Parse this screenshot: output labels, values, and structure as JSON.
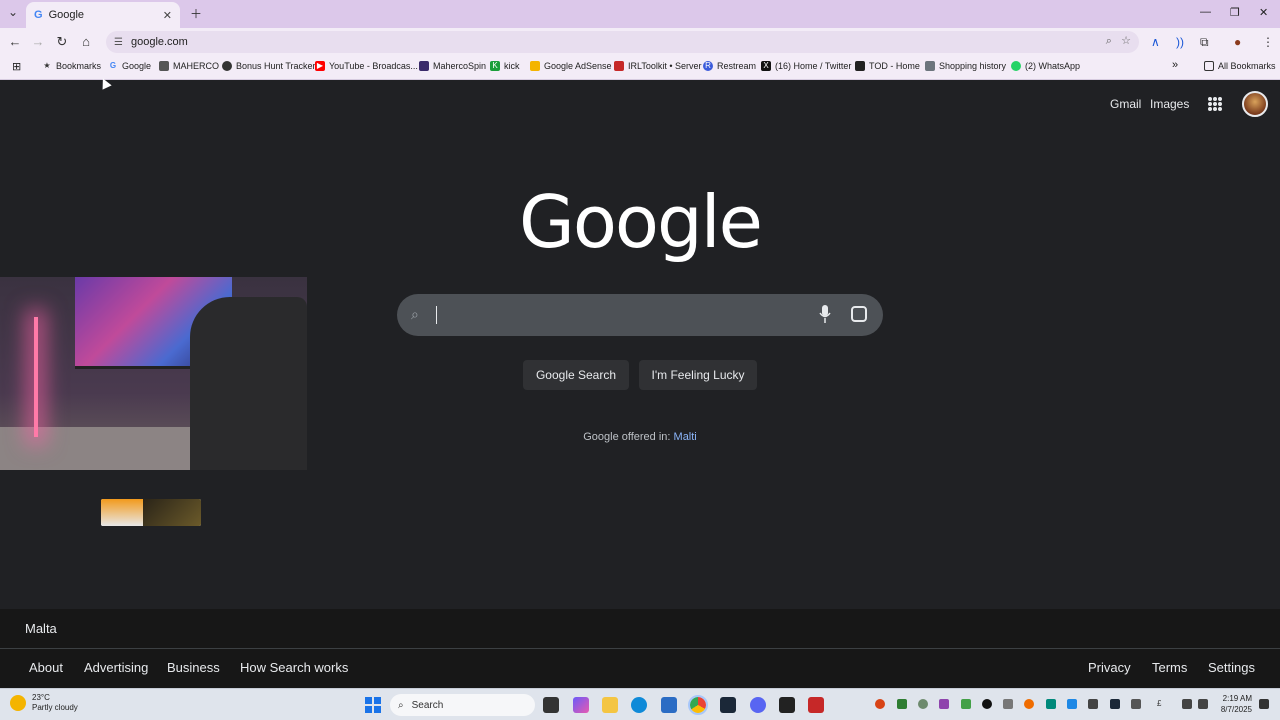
{
  "browser": {
    "tab": {
      "title": "Google",
      "favicon": "G"
    },
    "address": "google.com",
    "bookmarks": [
      {
        "label": "Bookmarks",
        "icon": "star-icon",
        "color": "#333333"
      },
      {
        "label": "Google",
        "icon": "google-icon",
        "color": "#4285f4"
      },
      {
        "label": "MAHERCO",
        "icon": "maherco-icon",
        "color": "#555555"
      },
      {
        "label": "Bonus Hunt Tracker",
        "icon": "globe-icon",
        "color": "#333333"
      },
      {
        "label": "YouTube - Broadcas...",
        "icon": "youtube-icon",
        "color": "#ff0000"
      },
      {
        "label": "MahercoSpin",
        "icon": "maherco-spin-icon",
        "color": "#3a2a6a"
      },
      {
        "label": "kick",
        "icon": "kick-icon",
        "color": "#1a9e3a"
      },
      {
        "label": "Google AdSense",
        "icon": "adsense-icon",
        "color": "#f4b400"
      },
      {
        "label": "IRLToolkit • Server",
        "icon": "irltoolkit-icon",
        "color": "#c62828"
      },
      {
        "label": "Restream",
        "icon": "restream-icon",
        "color": "#3b5bdb"
      },
      {
        "label": "(16) Home / Twitter",
        "icon": "x-icon",
        "color": "#111111"
      },
      {
        "label": "TOD - Home",
        "icon": "tod-icon",
        "color": "#222222"
      },
      {
        "label": "Shopping history",
        "icon": "shopping-icon",
        "color": "#6c757d"
      },
      {
        "label": "(2) WhatsApp",
        "icon": "whatsapp-icon",
        "color": "#25d366"
      }
    ],
    "all_bookmarks": "All Bookmarks"
  },
  "google": {
    "top_links": [
      "Gmail",
      "Images"
    ],
    "logo": "Google",
    "buttons": {
      "search": "Google Search",
      "lucky": "I'm Feeling Lucky"
    },
    "offered_prefix": "Google offered in: ",
    "offered_lang": "Malti",
    "country": "Malta",
    "footer_left": [
      "About",
      "Advertising",
      "Business",
      "How Search works"
    ],
    "footer_right": [
      "Privacy",
      "Terms",
      "Settings"
    ]
  },
  "taskbar": {
    "weather_temp": "23°C",
    "weather_desc": "Partly cloudy",
    "search_label": "Search",
    "time": "2:19 AM",
    "date": "8/7/2025"
  },
  "colors": {
    "page_bg": "#202124",
    "tabstrip": "#dcc8ea",
    "toolbar": "#f3ecf7",
    "link": "#8ab4f8"
  }
}
